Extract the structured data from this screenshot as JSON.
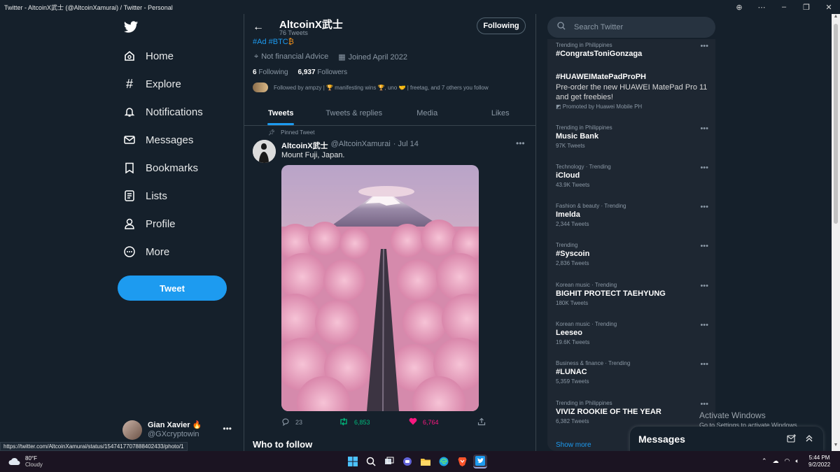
{
  "window": {
    "title": "Twitter - AltcoinX武士 (@AltcoinXamurai) / Twitter - Personal"
  },
  "nav": {
    "items": [
      {
        "label": "Home",
        "icon": "home-icon"
      },
      {
        "label": "Explore",
        "icon": "hashtag-icon"
      },
      {
        "label": "Notifications",
        "icon": "bell-icon"
      },
      {
        "label": "Messages",
        "icon": "envelope-icon"
      },
      {
        "label": "Bookmarks",
        "icon": "bookmark-icon"
      },
      {
        "label": "Lists",
        "icon": "list-icon"
      },
      {
        "label": "Profile",
        "icon": "person-icon"
      },
      {
        "label": "More",
        "icon": "more-circle-icon"
      }
    ],
    "tweet_button": "Tweet"
  },
  "account": {
    "name": "Gian Xavier 🔥",
    "handle": "@GXcryptowin"
  },
  "profile": {
    "name": "AltcoinX武士",
    "tweet_count": "76 Tweets",
    "following_button": "Following",
    "tags": "#Ad #BTC",
    "bio_meta": "Not financial Advice",
    "joined": "Joined April 2022",
    "following_count": "6",
    "following_label": "Following",
    "followers_count": "6,937",
    "followers_label": "Followers",
    "followed_by": "Followed by ampzy | 🏆 manifesting wins 🏆, uno 🤝 | freetag, and 7 others you follow"
  },
  "tabs": [
    "Tweets",
    "Tweets & replies",
    "Media",
    "Likes"
  ],
  "tweet": {
    "pinned_label": "Pinned Tweet",
    "author": "AltcoinX武士",
    "handle": "@AltcoinXamurai",
    "date": "· Jul 14",
    "text": "Mount Fuji, Japan.",
    "replies": "23",
    "retweets": "6,853",
    "likes": "6,764"
  },
  "who_to_follow": "Who to follow",
  "status_url": "https://twitter.com/AltcoinXamurai/status/1547417707888402433/photo/1",
  "search": {
    "placeholder": "Search Twitter"
  },
  "trends": [
    {
      "category": "Trending in Philippines",
      "title": "#CongratsToniGonzaga",
      "count": ""
    },
    {
      "category": "",
      "title": "#HUAWEIMatePadProPH",
      "desc": "Pre-order the new HUAWEI MatePad Pro 11 and get freebies!",
      "promo": "Promoted by Huawei Mobile PH"
    },
    {
      "category": "Trending in Philippines",
      "title": "Music Bank",
      "count": "97K Tweets"
    },
    {
      "category": "Technology · Trending",
      "title": "iCloud",
      "count": "43.9K Tweets"
    },
    {
      "category": "Fashion & beauty · Trending",
      "title": "Imelda",
      "count": "2,344 Tweets"
    },
    {
      "category": "Trending",
      "title": "#Syscoin",
      "count": "2,836 Tweets"
    },
    {
      "category": "Korean music · Trending",
      "title": "BIGHIT PROTECT TAEHYUNG",
      "count": "180K Tweets"
    },
    {
      "category": "Korean music · Trending",
      "title": "Leeseo",
      "count": "19.6K Tweets"
    },
    {
      "category": "Business & finance · Trending",
      "title": "#LUNAC",
      "count": "5,359 Tweets"
    },
    {
      "category": "Trending in Philippines",
      "title": "VIVIZ ROOKIE OF THE YEAR",
      "count": "6,382 Tweets"
    }
  ],
  "show_more": "Show more",
  "messages_drawer": "Messages",
  "activate_windows": {
    "title": "Activate Windows",
    "subtitle": "Go to Settings to activate Windows."
  },
  "taskbar": {
    "temperature": "80°F",
    "condition": "Cloudy",
    "time": "5:44 PM",
    "date": "9/2/2022"
  },
  "colors": {
    "background": "#15202b",
    "accent": "#1d9bf0",
    "retweet": "#00ba7c",
    "like": "#f91880"
  }
}
